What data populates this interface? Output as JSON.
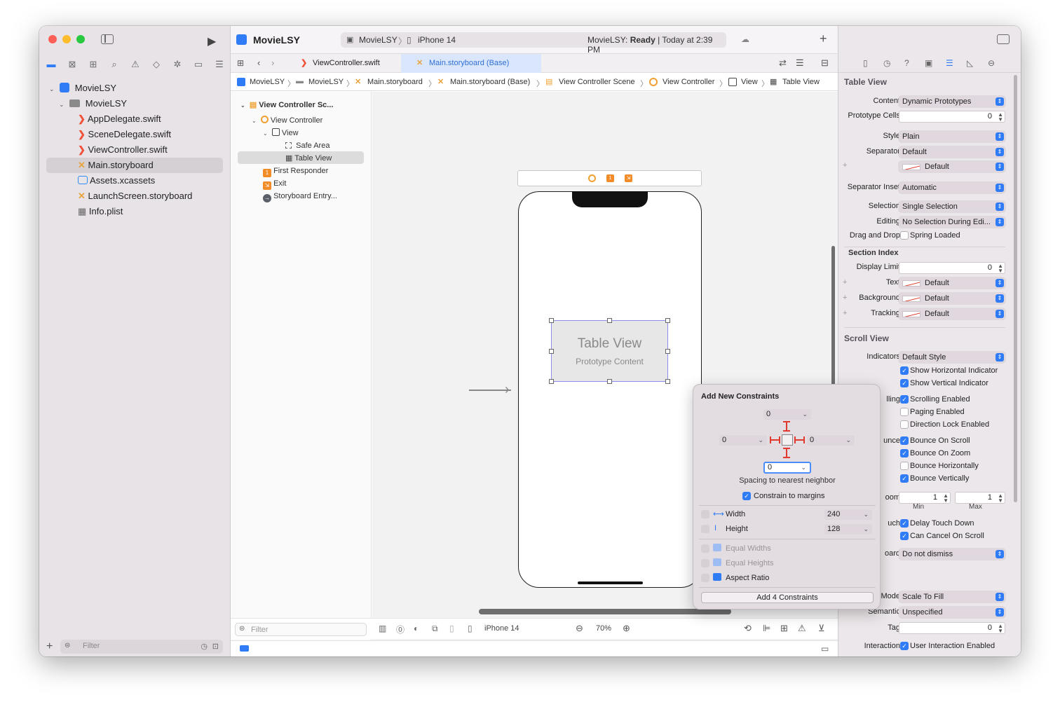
{
  "project": {
    "name": "MovieLSY"
  },
  "toolbar": {
    "scheme": "MovieLSY",
    "device": "iPhone 14",
    "status_prefix": "MovieLSY:",
    "status_state": "Ready",
    "status_time": "| Today at 2:39 PM"
  },
  "navigator": {
    "items": [
      {
        "label": "MovieLSY",
        "icon": "project-icon"
      },
      {
        "label": "MovieLSY",
        "icon": "folder-icon"
      },
      {
        "label": "AppDelegate.swift",
        "icon": "swift-icon"
      },
      {
        "label": "SceneDelegate.swift",
        "icon": "swift-icon"
      },
      {
        "label": "ViewController.swift",
        "icon": "swift-icon"
      },
      {
        "label": "Main.storyboard",
        "icon": "storyboard-icon"
      },
      {
        "label": "Assets.xcassets",
        "icon": "assets-icon"
      },
      {
        "label": "LaunchScreen.storyboard",
        "icon": "storyboard-icon"
      },
      {
        "label": "Info.plist",
        "icon": "plist-icon"
      }
    ],
    "filter_placeholder": "Filter"
  },
  "tabs": [
    {
      "label": "ViewController.swift",
      "active": false
    },
    {
      "label": "Main.storyboard (Base)",
      "active": true
    }
  ],
  "breadcrumb": [
    "MovieLSY",
    "MovieLSY",
    "Main.storyboard",
    "Main.storyboard (Base)",
    "View Controller Scene",
    "View Controller",
    "View",
    "Table View"
  ],
  "outline": {
    "items": [
      "View Controller Sc...",
      "View Controller",
      "View",
      "Safe Area",
      "Table View",
      "First Responder",
      "Exit",
      "Storyboard Entry..."
    ],
    "filter_placeholder": "Filter"
  },
  "canvas": {
    "table_title": "Table View",
    "table_subtitle": "Prototype Content",
    "device": "iPhone 14",
    "zoom": "70%"
  },
  "constraints": {
    "title": "Add New Constraints",
    "top": "0",
    "left": "0",
    "right": "0",
    "bottom": "0",
    "spacing_label": "Spacing to nearest neighbor",
    "margins_label": "Constrain to margins",
    "width_label": "Width",
    "width_value": "240",
    "height_label": "Height",
    "height_value": "128",
    "equal_widths": "Equal Widths",
    "equal_heights": "Equal Heights",
    "aspect_ratio": "Aspect Ratio",
    "add_button": "Add 4 Constraints"
  },
  "inspector": {
    "section_table": "Table View",
    "content_label": "Content",
    "content_value": "Dynamic Prototypes",
    "proto_label": "Prototype Cells",
    "proto_value": "0",
    "style_label": "Style",
    "style_value": "Plain",
    "separator_label": "Separator",
    "separator_value": "Default",
    "sepcolor_value": "Default",
    "sepinset_label": "Separator Inset",
    "sepinset_value": "Automatic",
    "selection_label": "Selection",
    "selection_value": "Single Selection",
    "editing_label": "Editing",
    "editing_value": "No Selection During Edi...",
    "dragdrop_label": "Drag and Drop",
    "dragdrop_value": "Spring Loaded",
    "section_index": "Section Index",
    "display_limit_label": "Display Limit",
    "display_limit_value": "0",
    "text_label": "Text",
    "text_value": "Default",
    "background_label": "Background",
    "background_value": "Default",
    "tracking_label": "Tracking",
    "tracking_value": "Default",
    "section_scroll": "Scroll View",
    "indicators_label": "Indicators",
    "indicators_value": "Default Style",
    "show_h": "Show Horizontal Indicator",
    "show_v": "Show Vertical Indicator",
    "scrolling_label": "lling",
    "scrolling_value": "Scrolling Enabled",
    "paging": "Paging Enabled",
    "direction_lock": "Direction Lock Enabled",
    "bounce_label": "unce",
    "bounce_scroll": "Bounce On Scroll",
    "bounce_zoom": "Bounce On Zoom",
    "bounce_h": "Bounce Horizontally",
    "bounce_v": "Bounce Vertically",
    "zoom_label": "oom",
    "zoom_min": "1",
    "zoom_max": "1",
    "min_label": "Min",
    "max_label": "Max",
    "touch_label": "uch",
    "delay_touch": "Delay Touch Down",
    "cancel_scroll": "Can Cancel On Scroll",
    "keyboard_label": "oard",
    "keyboard_value": "Do not dismiss",
    "mode_label": "Mode",
    "mode_value": "Scale To Fill",
    "semantic_label": "Semantic",
    "semantic_value": "Unspecified",
    "tag_label": "Tag",
    "tag_value": "0",
    "interaction_label": "Interaction",
    "interaction_value": "User Interaction Enabled"
  },
  "colors": {
    "accent": "#2f7cf6",
    "swift": "#f05138",
    "storyboard": "#e8a33d"
  }
}
